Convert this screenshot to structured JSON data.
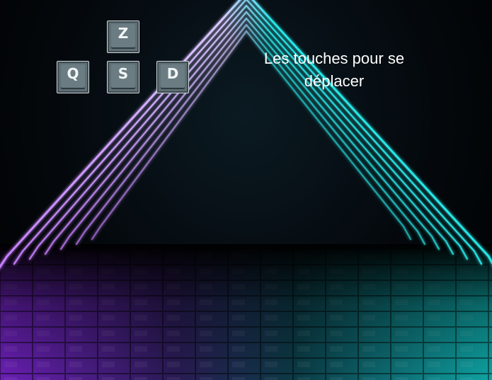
{
  "keys": {
    "up": "Z",
    "left": "Q",
    "down": "S",
    "right": "D"
  },
  "hint": {
    "text": "Les touches pour se déplacer"
  },
  "colors": {
    "neon_purple": "#c77dff",
    "neon_cyan": "#27e6e6",
    "key_face": "#5f6f76"
  }
}
